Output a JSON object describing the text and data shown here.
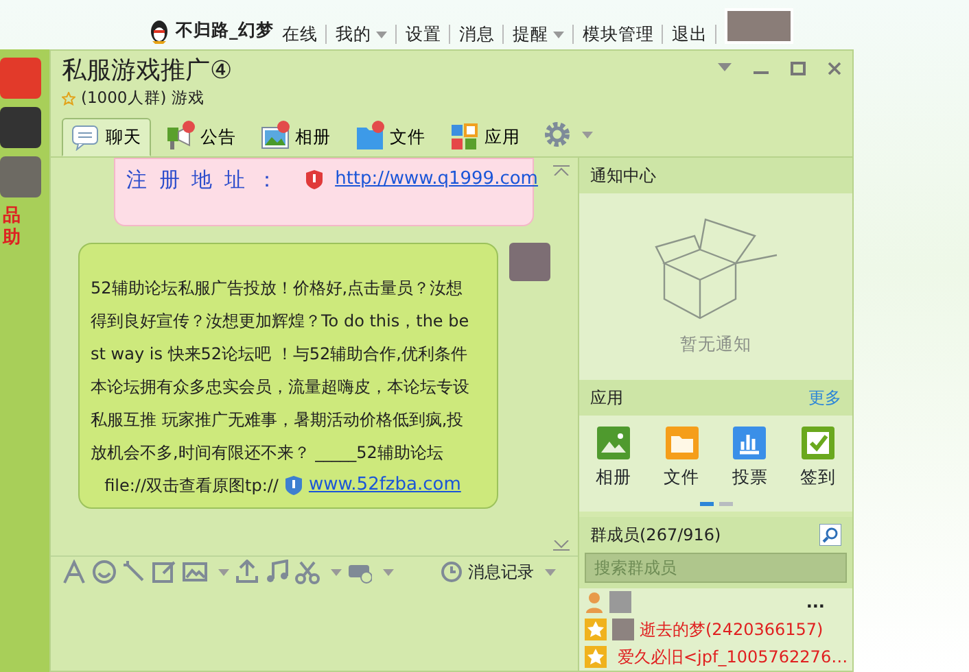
{
  "top_bar": {
    "username": "不归路_幻梦",
    "status": "在线",
    "menu": [
      {
        "label": "我的",
        "dropdown": true
      },
      {
        "label": "设置",
        "dropdown": false
      },
      {
        "label": "消息",
        "dropdown": false
      },
      {
        "label": "提醒",
        "dropdown": true
      },
      {
        "label": "模块管理",
        "dropdown": false
      },
      {
        "label": "退出",
        "dropdown": false
      }
    ]
  },
  "left_strip": {
    "labels": [
      "品",
      "助"
    ]
  },
  "window": {
    "title": "私服游戏推广④",
    "subtitle": "(1000人群) 游戏"
  },
  "tabs": [
    {
      "label": "聊天",
      "selected": true,
      "badge": false,
      "kind": "chat"
    },
    {
      "label": "公告",
      "selected": false,
      "badge": true,
      "kind": "notice"
    },
    {
      "label": "相册",
      "selected": false,
      "badge": true,
      "kind": "album"
    },
    {
      "label": "文件",
      "selected": false,
      "badge": true,
      "kind": "file"
    },
    {
      "label": "应用",
      "selected": false,
      "badge": false,
      "kind": "apps"
    }
  ],
  "messages": [
    {
      "kind": "banner",
      "label": "注 册 地 址 ：",
      "link": "http://www.q1999.com"
    },
    {
      "kind": "bubble",
      "text": "52辅助论坛私服广告投放！价格好,点击量员？汝想得到良好宣传？汝想更加辉煌？To do this，the best way is 快来52论坛吧 ！与52辅助合作,优利条件本论坛拥有众多忠实会员，流量超嗨皮，本论坛专设私服互推 玩家推广无难事，暑期活动价格低到疯,投放机会不多,时间有限还不来？ _____52辅助论坛",
      "link_prefix": "file://双击查看原图tp://",
      "link": "www.52fzba.com"
    }
  ],
  "input_toolbar": {
    "history": "消息记录"
  },
  "notification_center": {
    "title": "通知中心",
    "empty_text": "暂无通知"
  },
  "apps": {
    "title": "应用",
    "more": "更多",
    "items": [
      {
        "label": "相册",
        "kind": "album"
      },
      {
        "label": "文件",
        "kind": "file"
      },
      {
        "label": "投票",
        "kind": "vote"
      },
      {
        "label": "签到",
        "kind": "checkin"
      }
    ],
    "pages": [
      {
        "selected": true
      },
      {
        "selected": false
      }
    ]
  },
  "members": {
    "title": "群成员(267/916)",
    "search_placeholder": "搜索群成员",
    "list": [
      {
        "kind": "header",
        "name": "..."
      },
      {
        "kind": "member",
        "name": "逝去的梦(2420366157)"
      },
      {
        "kind": "member",
        "name": "爱久必旧<jpf_1005762276…"
      }
    ]
  }
}
